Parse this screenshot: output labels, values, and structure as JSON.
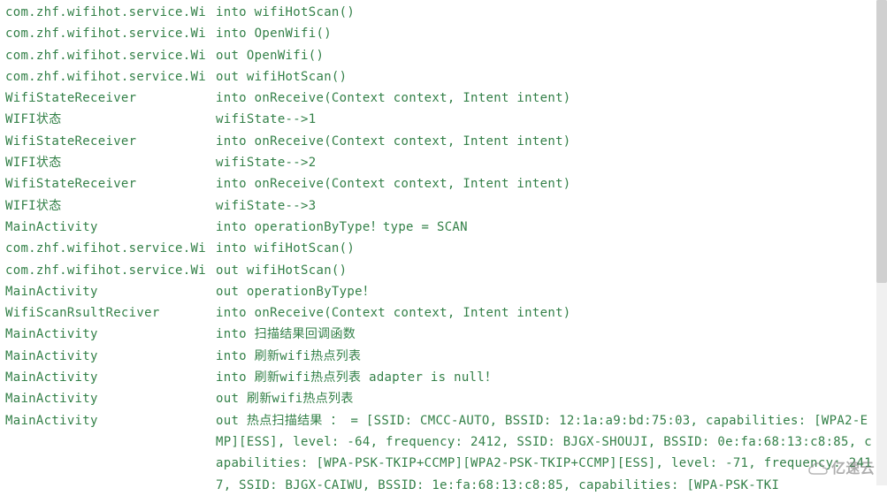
{
  "rows": [
    {
      "tag": "com.zhf.wifihot.service.Wi",
      "msg": "into wifiHotScan()"
    },
    {
      "tag": "com.zhf.wifihot.service.Wi",
      "msg": "into OpenWifi()"
    },
    {
      "tag": "com.zhf.wifihot.service.Wi",
      "msg": "out OpenWifi()"
    },
    {
      "tag": "com.zhf.wifihot.service.Wi",
      "msg": "out wifiHotScan()"
    },
    {
      "tag": "WifiStateReceiver",
      "msg": "into onReceive(Context context, Intent intent)"
    },
    {
      "tag": "WIFI状态",
      "msg": "wifiState-->1"
    },
    {
      "tag": "WifiStateReceiver",
      "msg": "into onReceive(Context context, Intent intent)"
    },
    {
      "tag": "WIFI状态",
      "msg": "wifiState-->2"
    },
    {
      "tag": "WifiStateReceiver",
      "msg": "into onReceive(Context context, Intent intent)"
    },
    {
      "tag": "WIFI状态",
      "msg": "wifiState-->3"
    },
    {
      "tag": "MainActivity",
      "msg": "into operationByType！type = SCAN"
    },
    {
      "tag": "com.zhf.wifihot.service.Wi",
      "msg": "into wifiHotScan()"
    },
    {
      "tag": "com.zhf.wifihot.service.Wi",
      "msg": "out wifiHotScan()"
    },
    {
      "tag": "MainActivity",
      "msg": "out operationByType！"
    },
    {
      "tag": "WifiScanRsultReciver",
      "msg": "into onReceive(Context context, Intent intent)"
    },
    {
      "tag": "MainActivity",
      "msg": "into 扫描结果回调函数"
    },
    {
      "tag": "MainActivity",
      "msg": "into 刷新wifi热点列表"
    },
    {
      "tag": "MainActivity",
      "msg": "into 刷新wifi热点列表 adapter is null！"
    },
    {
      "tag": "MainActivity",
      "msg": "out 刷新wifi热点列表"
    },
    {
      "tag": "MainActivity",
      "msg": "out 热点扫描结果 ：  = [SSID: CMCC-AUTO, BSSID: 12:1a:a9:bd:75:03, capabilities: [WPA2-E"
    },
    {
      "tag": "",
      "msg": "MP][ESS], level: -64, frequency: 2412, SSID: BJGX-SHOUJI, BSSID: 0e:fa:68:13:c8:85, c"
    },
    {
      "tag": "",
      "msg": "apabilities: [WPA-PSK-TKIP+CCMP][WPA2-PSK-TKIP+CCMP][ESS], level: -71, frequency: 241"
    },
    {
      "tag": "",
      "msg": "7, SSID: BJGX-CAIWU, BSSID: 1e:fa:68:13:c8:85, capabilities: [WPA-PSK-TKI"
    }
  ],
  "watermark": {
    "text": "亿速云"
  }
}
